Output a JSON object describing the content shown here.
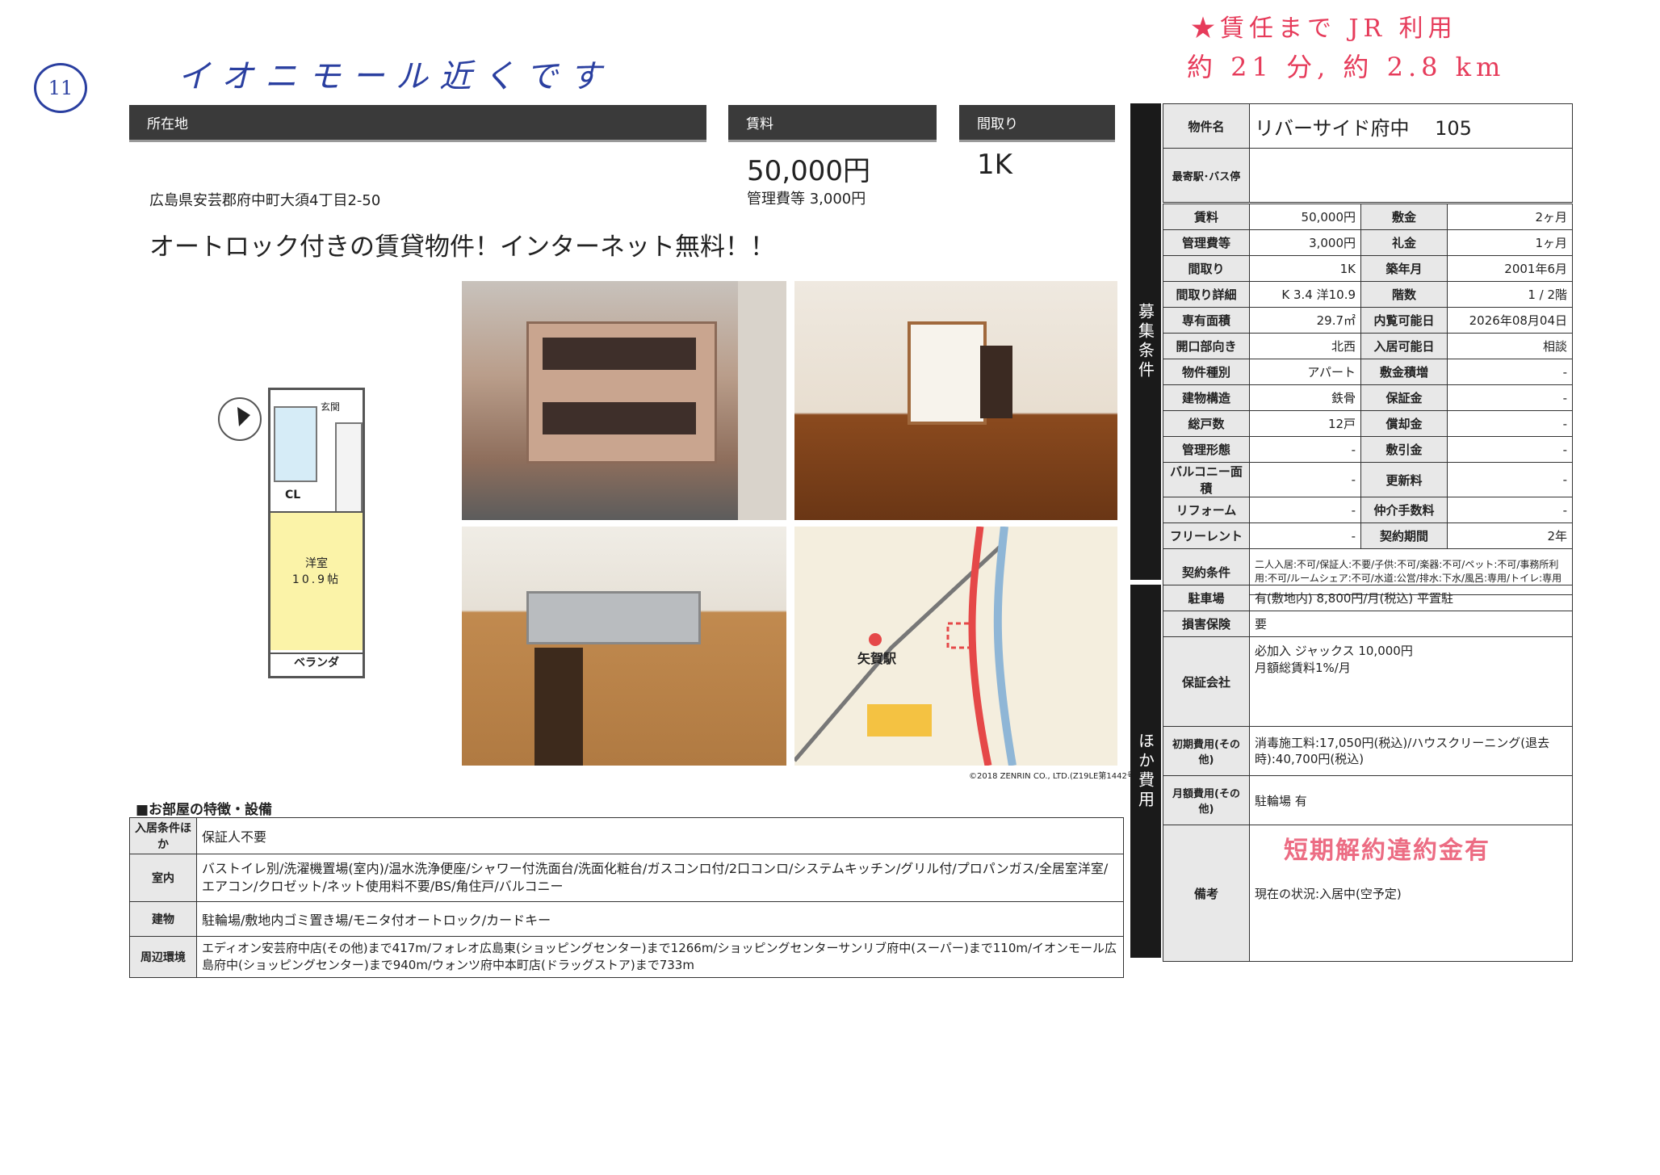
{
  "handwritten": {
    "number": "11",
    "note": "イオニモール近くです",
    "top_right_line1": "★賃任まで JR 利用",
    "top_right_line2": "約 21 分, 約 2.8 km"
  },
  "headers": {
    "location": "所在地",
    "rent": "賃料",
    "layout": "間取り"
  },
  "address": "広島県安芸郡府中町大須4丁目2-50",
  "rent_value": "50,000円",
  "mgmt_fee": "管理費等 3,000円",
  "layout_value": "1K",
  "catchcopy": "オートロック付きの賃貸物件！インターネット無料！！",
  "floorplan": {
    "genkan": "玄関",
    "cl": "CL",
    "room": "洋室",
    "room_size": "10.9帖",
    "veranda": "ベランダ"
  },
  "map": {
    "station": "矢賀駅",
    "copyright": "©2018 ZENRIN CO., LTD.(Z19LE第1442号)"
  },
  "property": {
    "label": "物件名",
    "value": "リバーサイド府中　 105",
    "station_label": "最寄駅･バス停",
    "station_value": ""
  },
  "side_labels": {
    "recruit": "募集条件",
    "other": "ほか費用"
  },
  "spec_rows": [
    {
      "l1": "賃料",
      "v1": "50,000円",
      "l2": "敷金",
      "v2": "2ヶ月"
    },
    {
      "l1": "管理費等",
      "v1": "3,000円",
      "l2": "礼金",
      "v2": "1ヶ月"
    },
    {
      "l1": "間取り",
      "v1": "1K",
      "l2": "築年月",
      "v2": "2001年6月"
    },
    {
      "l1": "間取り詳細",
      "v1": "K 3.4 洋10.9",
      "l2": "階数",
      "v2": "1 / 2階"
    },
    {
      "l1": "専有面積",
      "v1": "29.7㎡",
      "l2": "内覧可能日",
      "v2": "2026年08月04日"
    },
    {
      "l1": "開口部向き",
      "v1": "北西",
      "l2": "入居可能日",
      "v2": "相談"
    },
    {
      "l1": "物件種別",
      "v1": "アパート",
      "l2": "敷金積増",
      "v2": "-"
    },
    {
      "l1": "建物構造",
      "v1": "鉄骨",
      "l2": "保証金",
      "v2": "-"
    },
    {
      "l1": "総戸数",
      "v1": "12戸",
      "l2": "償却金",
      "v2": "-"
    },
    {
      "l1": "管理形態",
      "v1": "-",
      "l2": "敷引金",
      "v2": "-"
    },
    {
      "l1": "バルコニー面積",
      "v1": "-",
      "l2": "更新料",
      "v2": "-"
    },
    {
      "l1": "リフォーム",
      "v1": "-",
      "l2": "仲介手数料",
      "v2": "-"
    },
    {
      "l1": "フリーレント",
      "v1": "-",
      "l2": "契約期間",
      "v2": "2年"
    }
  ],
  "contract": {
    "label": "契約条件",
    "value": "二人入居:不可/保証人:不要/子供:不可/楽器:不可/ペット:不可/事務所利用:不可/ルームシェア:不可/水道:公営/排水:下水/風呂:専用/トイレ:専用"
  },
  "other_rows": [
    {
      "label": "駐車場",
      "value": "有(敷地内) 8,800円/月(税込) 平置駐"
    },
    {
      "label": "損害保険",
      "value": "要"
    },
    {
      "label": "保証会社",
      "value": "必加入 ジャックス 10,000円\n月額総賃料1%/月"
    },
    {
      "label": "初期費用(その他)",
      "value": "消毒施工料:17,050円(税込)/ハウスクリーニング(退去時):40,700円(税込)"
    },
    {
      "label": "月額費用(その他)",
      "value": "駐輪場 有"
    },
    {
      "label": "備考",
      "value": "現在の状況:入居中(空予定)"
    }
  ],
  "stamp": "短期解約違約金有",
  "features": {
    "title": "■お部屋の特徴・設備",
    "rows": [
      {
        "label": "入居条件ほか",
        "value": "保証人不要"
      },
      {
        "label": "室内",
        "value": "バストイレ別/洗濯機置場(室内)/温水洗浄便座/シャワー付洗面台/洗面化粧台/ガスコンロ付/2口コンロ/システムキッチン/グリル付/プロパンガス/全居室洋室/エアコン/クロゼット/ネット使用料不要/BS/角住戸/バルコニー"
      },
      {
        "label": "建物",
        "value": "駐輪場/敷地内ゴミ置き場/モニタ付オートロック/カードキー"
      },
      {
        "label": "周辺環境",
        "value": "エディオン安芸府中店(その他)まで417m/フォレオ広島東(ショッピングセンター)まで1266m/ショッピングセンターサンリブ府中(スーパー)まで110m/イオンモール広島府中(ショッピングセンター)まで940m/ウォンツ府中本町店(ドラッグストア)まで733m"
      }
    ]
  }
}
